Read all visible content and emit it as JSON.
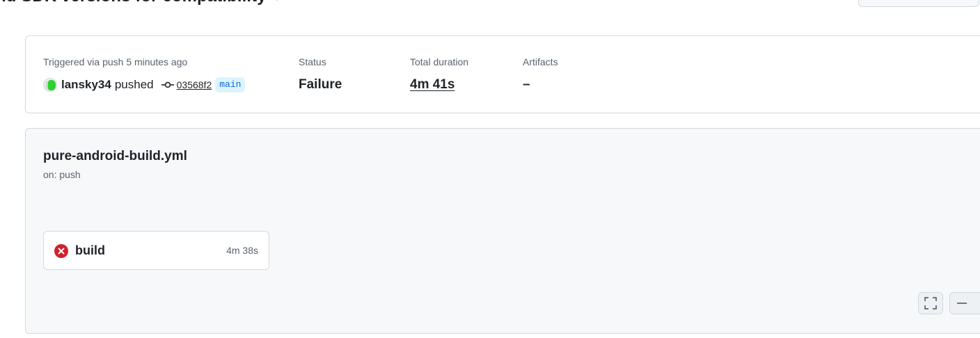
{
  "header": {
    "title": "nd SDK versions for compatibility",
    "extra_glyph": "↗"
  },
  "summary": {
    "trigger_label": "Triggered via push 5 minutes ago",
    "actor": "lansky34",
    "action": "pushed",
    "commit_sha": "03568f2",
    "branch": "main",
    "status_label": "Status",
    "status_value": "Failure",
    "duration_label": "Total duration",
    "duration_value": "4m 41s",
    "artifacts_label": "Artifacts",
    "artifacts_value": "–"
  },
  "workflow": {
    "file": "pure-android-build.yml",
    "trigger": "on: push",
    "jobs": [
      {
        "name": "build",
        "duration": "4m 38s",
        "status": "failure"
      }
    ]
  },
  "colors": {
    "failure": "#cf222e",
    "branch_text": "#0969da",
    "branch_bg": "#ddf4ff",
    "muted_text": "#59636e",
    "border": "#d1d9e0"
  },
  "icons": {
    "commit": "git-commit-icon",
    "job_status": "x-circle-fill-icon",
    "fullscreen": "screen-full-icon",
    "zoom_out": "dash-icon"
  }
}
